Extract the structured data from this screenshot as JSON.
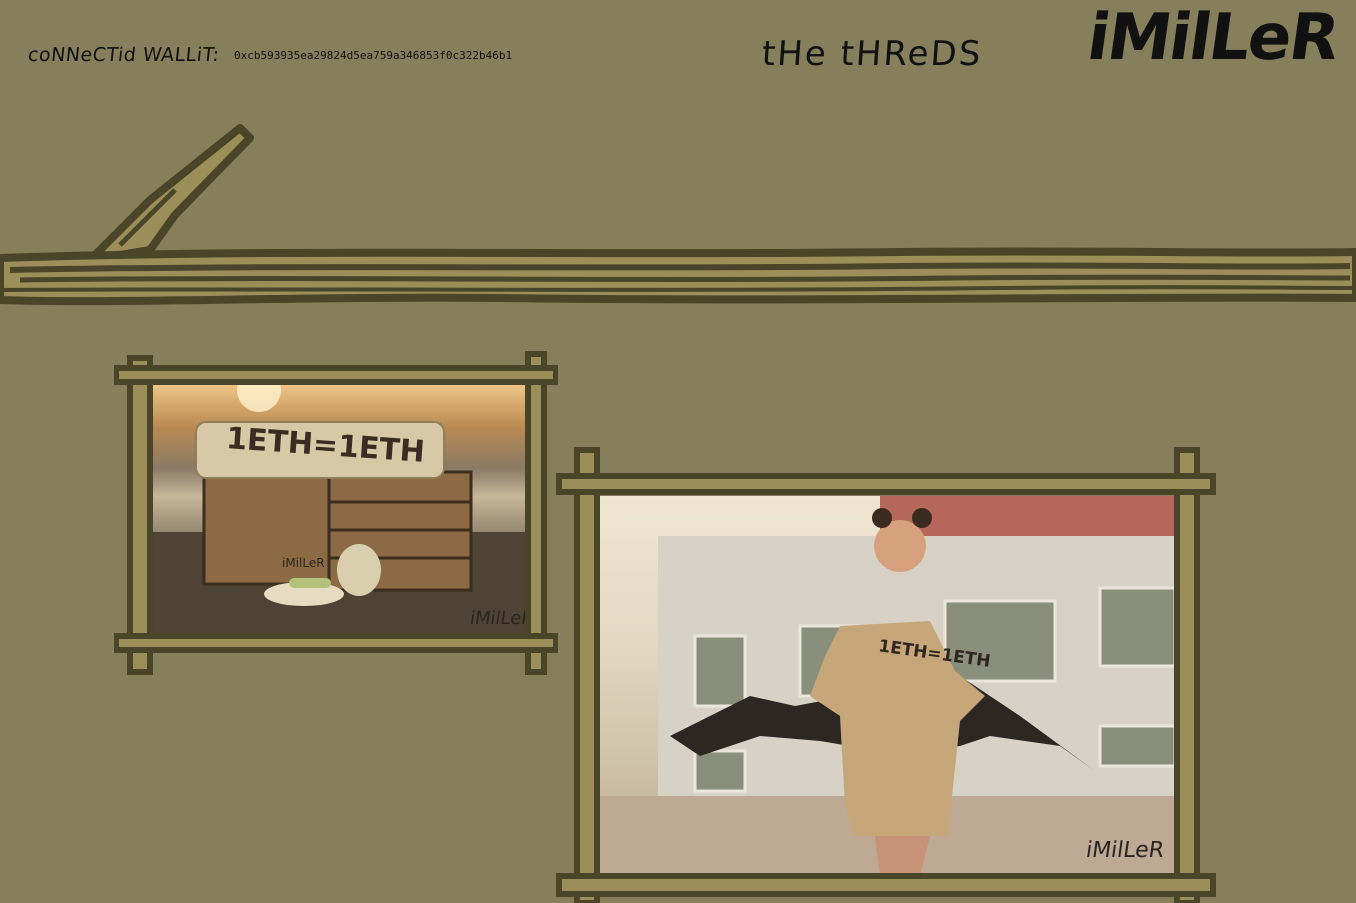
{
  "header": {
    "wallet_label": "coNNeCTid WALLiT:",
    "wallet_address": "0xcb593935ea29824d5ea759a346853f0c322b46b1",
    "title": "tHe tHReDS",
    "logo": "iMilLeR"
  },
  "gallery": {
    "photo1": {
      "shirt_text": "1ETH=1ETH",
      "watermark": "iMilLeR",
      "crate_logo": "iMilLeR"
    },
    "photo2": {
      "shirt_text": "1ETH=1ETH",
      "watermark": "iMilLeR"
    }
  },
  "colors": {
    "background": "#857f5c",
    "branch_dark": "#4a4428",
    "branch_light": "#9c8e58"
  }
}
